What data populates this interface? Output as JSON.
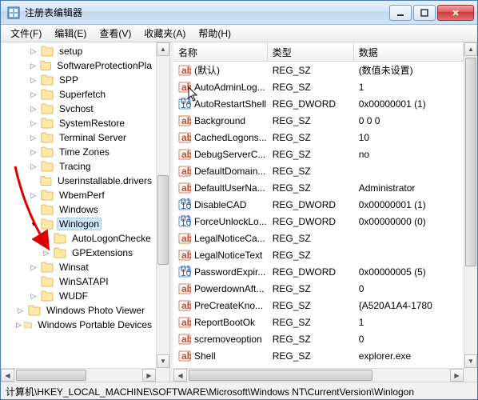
{
  "window": {
    "title": "注册表编辑器"
  },
  "menu": [
    "文件(F)",
    "编辑(E)",
    "查看(V)",
    "收藏夹(A)",
    "帮助(H)"
  ],
  "tree": {
    "items": [
      {
        "indent": 2,
        "exp": "closed",
        "label": "setup"
      },
      {
        "indent": 2,
        "exp": "closed",
        "label": "SoftwareProtectionPla"
      },
      {
        "indent": 2,
        "exp": "closed",
        "label": "SPP"
      },
      {
        "indent": 2,
        "exp": "closed",
        "label": "Superfetch"
      },
      {
        "indent": 2,
        "exp": "closed",
        "label": "Svchost"
      },
      {
        "indent": 2,
        "exp": "closed",
        "label": "SystemRestore"
      },
      {
        "indent": 2,
        "exp": "closed",
        "label": "Terminal Server"
      },
      {
        "indent": 2,
        "exp": "closed",
        "label": "Time Zones"
      },
      {
        "indent": 2,
        "exp": "closed",
        "label": "Tracing"
      },
      {
        "indent": 2,
        "exp": "none",
        "label": "Userinstallable.drivers"
      },
      {
        "indent": 2,
        "exp": "closed",
        "label": "WbemPerf"
      },
      {
        "indent": 2,
        "exp": "none",
        "label": "Windows"
      },
      {
        "indent": 2,
        "exp": "open",
        "label": "Winlogon",
        "selected": true
      },
      {
        "indent": 3,
        "exp": "none",
        "label": "AutoLogonChecke"
      },
      {
        "indent": 3,
        "exp": "closed",
        "label": "GPExtensions"
      },
      {
        "indent": 2,
        "exp": "closed",
        "label": "Winsat"
      },
      {
        "indent": 2,
        "exp": "none",
        "label": "WinSATAPI"
      },
      {
        "indent": 2,
        "exp": "closed",
        "label": "WUDF"
      },
      {
        "indent": 1,
        "exp": "closed",
        "label": "Windows Photo Viewer"
      },
      {
        "indent": 1,
        "exp": "closed",
        "label": "Windows Portable Devices"
      }
    ]
  },
  "columns": {
    "name": "名称",
    "type": "类型",
    "data": "数据"
  },
  "values": [
    {
      "icon": "sz",
      "name": "(默认)",
      "type": "REG_SZ",
      "data": "(数值未设置)"
    },
    {
      "icon": "sz",
      "name": "AutoAdminLog...",
      "type": "REG_SZ",
      "data": "1"
    },
    {
      "icon": "bin",
      "name": "AutoRestartShell",
      "type": "REG_DWORD",
      "data": "0x00000001 (1)"
    },
    {
      "icon": "sz",
      "name": "Background",
      "type": "REG_SZ",
      "data": "0 0 0"
    },
    {
      "icon": "sz",
      "name": "CachedLogons...",
      "type": "REG_SZ",
      "data": "10"
    },
    {
      "icon": "sz",
      "name": "DebugServerC...",
      "type": "REG_SZ",
      "data": "no"
    },
    {
      "icon": "sz",
      "name": "DefaultDomain...",
      "type": "REG_SZ",
      "data": ""
    },
    {
      "icon": "sz",
      "name": "DefaultUserNa...",
      "type": "REG_SZ",
      "data": "Administrator"
    },
    {
      "icon": "bin",
      "name": "DisableCAD",
      "type": "REG_DWORD",
      "data": "0x00000001 (1)"
    },
    {
      "icon": "bin",
      "name": "ForceUnlockLo...",
      "type": "REG_DWORD",
      "data": "0x00000000 (0)"
    },
    {
      "icon": "sz",
      "name": "LegalNoticeCa...",
      "type": "REG_SZ",
      "data": ""
    },
    {
      "icon": "sz",
      "name": "LegalNoticeText",
      "type": "REG_SZ",
      "data": ""
    },
    {
      "icon": "bin",
      "name": "PasswordExpir...",
      "type": "REG_DWORD",
      "data": "0x00000005 (5)"
    },
    {
      "icon": "sz",
      "name": "PowerdownAft...",
      "type": "REG_SZ",
      "data": "0"
    },
    {
      "icon": "sz",
      "name": "PreCreateKno...",
      "type": "REG_SZ",
      "data": "{A520A1A4-1780"
    },
    {
      "icon": "sz",
      "name": "ReportBootOk",
      "type": "REG_SZ",
      "data": "1"
    },
    {
      "icon": "sz",
      "name": "scremoveoption",
      "type": "REG_SZ",
      "data": "0"
    },
    {
      "icon": "sz",
      "name": "Shell",
      "type": "REG_SZ",
      "data": "explorer.exe"
    }
  ],
  "colwidths": {
    "name": 120,
    "type": 110,
    "data": 140
  },
  "status": "计算机\\HKEY_LOCAL_MACHINE\\SOFTWARE\\Microsoft\\Windows NT\\CurrentVersion\\Winlogon"
}
